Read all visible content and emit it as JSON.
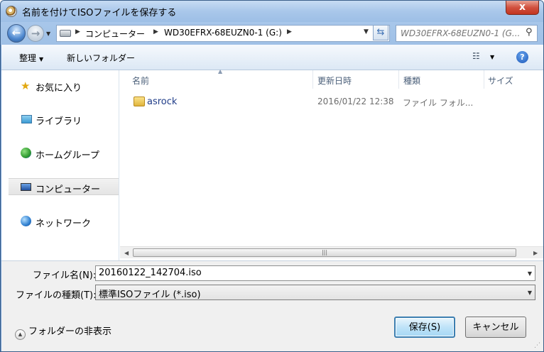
{
  "window": {
    "title": "名前を付けてISOファイルを保存する",
    "close_label": "x"
  },
  "address": {
    "breadcrumbs": [
      "コンピューター",
      "WD30EFRX-68EUZN0-1 (G:)"
    ],
    "search_placeholder": "WD30EFRX-68EUZN0-1 (G..."
  },
  "toolbar": {
    "organize_label": "整理",
    "new_folder_label": "新しいフォルダー"
  },
  "nav": {
    "items": [
      {
        "label": "お気に入り",
        "icon": "star-icon"
      },
      {
        "label": "ライブラリ",
        "icon": "library-icon"
      },
      {
        "label": "ホームグループ",
        "icon": "homegroup-icon"
      },
      {
        "label": "コンピューター",
        "icon": "computer-icon"
      },
      {
        "label": "ネットワーク",
        "icon": "network-icon"
      }
    ],
    "selected": "コンピューター"
  },
  "files": {
    "columns": [
      "名前",
      "更新日時",
      "種類",
      "サイズ"
    ],
    "rows": [
      {
        "name": "asrock",
        "modified": "2016/01/22 12:38",
        "type": "ファイル フォル...",
        "size": ""
      }
    ]
  },
  "form": {
    "filename_label": "ファイル名(N):",
    "filename_value": "20160122_142704.iso",
    "filetype_label": "ファイルの種類(T):",
    "filetype_value": "標準ISOファイル (*.iso)",
    "hide_folders_label": "フォルダーの非表示",
    "save_label": "保存(S)",
    "cancel_label": "キャンセル"
  }
}
